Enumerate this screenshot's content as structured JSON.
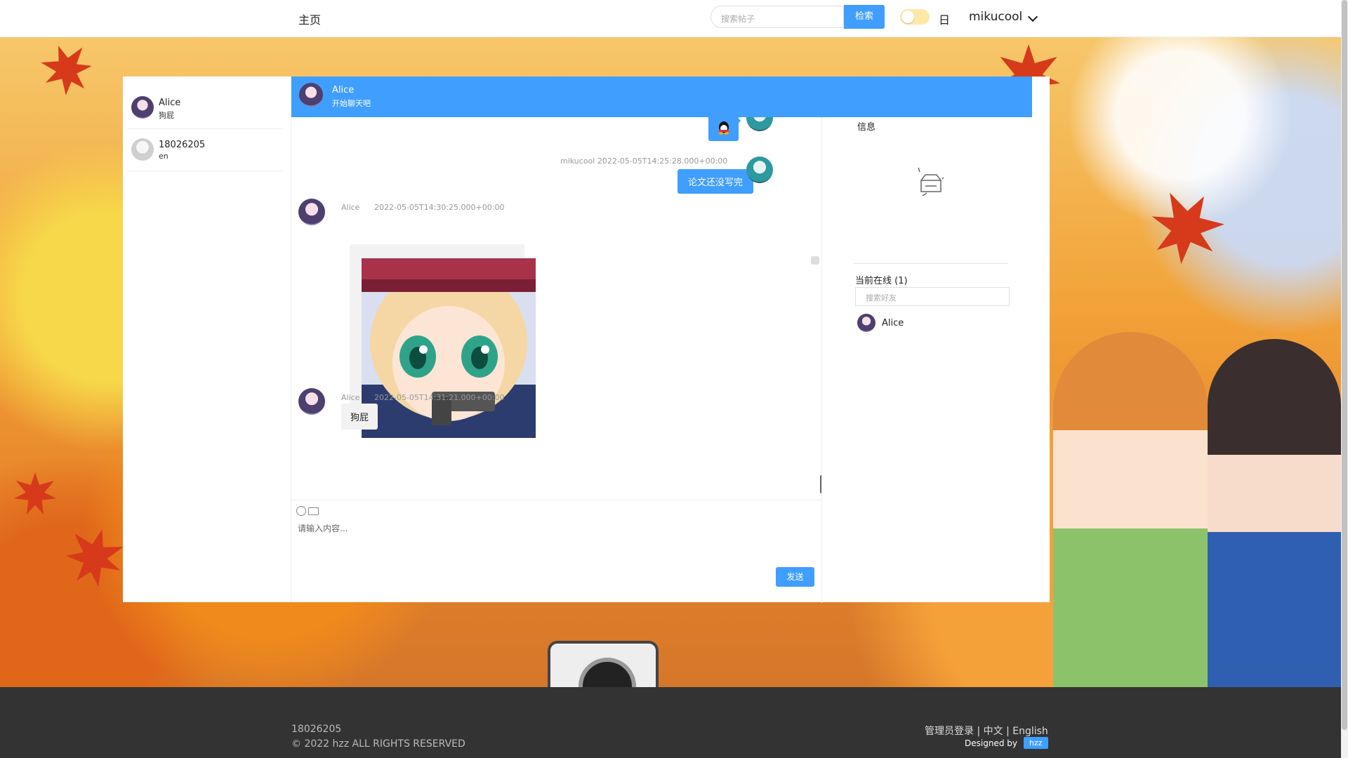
{
  "nav": {
    "home": "主页",
    "search_placeholder": "搜索帖子",
    "search_button": "检索",
    "theme_label": "日",
    "username": "mikucool"
  },
  "contacts": [
    {
      "name": "Alice",
      "last": "狗屁"
    },
    {
      "name": "18026205",
      "last": "en"
    }
  ],
  "chat_header": {
    "name": "Alice",
    "subtitle": "开始聊天吧"
  },
  "messages": [
    {
      "sender": "mikucool",
      "time": "mikucool 2022-05-05T14:25:28.000+00:00",
      "text": "论文还没写完"
    },
    {
      "sender": "Alice",
      "name": "Alice",
      "time": "2022-05-05T14:30:25.000+00:00",
      "type": "image"
    },
    {
      "sender": "Alice",
      "name": "Alice",
      "time": "2022-05-05T14:31:21.000+00:00",
      "text": "狗屁"
    }
  ],
  "composer": {
    "placeholder": "请输入内容...",
    "send": "发送"
  },
  "side": {
    "info_title": "信息",
    "online_title": "当前在线 (1)",
    "friend_search_placeholder": "搜索好友",
    "online_users": [
      "Alice"
    ]
  },
  "footer": {
    "id": "18026205",
    "copyright": "© 2022 hzz ALL RIGHTS RESERVED",
    "links": "管理员登录 | 中文 | English",
    "designed_by": "Designed by",
    "designer": "hzz"
  },
  "colors": {
    "accent": "#409eff",
    "footer": "#333333"
  }
}
